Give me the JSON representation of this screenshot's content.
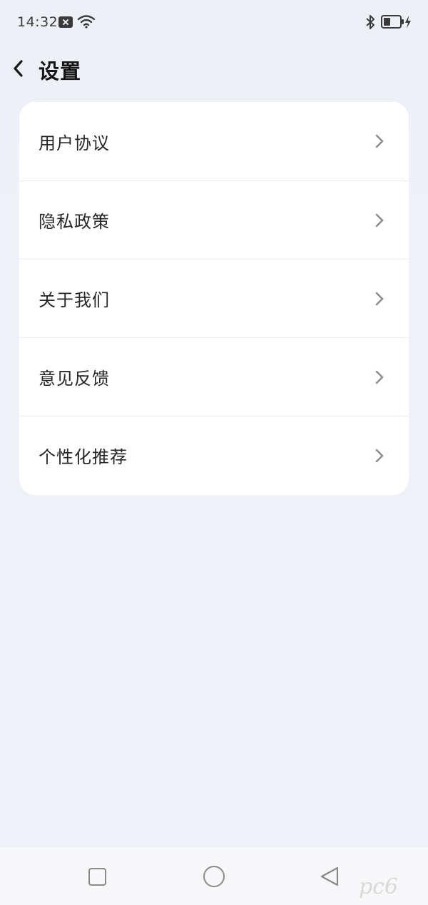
{
  "status_bar": {
    "time": "14:32",
    "icons": [
      "notification-x-icon",
      "wifi-icon",
      "bluetooth-icon",
      "battery-icon",
      "charging-icon"
    ]
  },
  "header": {
    "back_icon": "chevron-left-icon",
    "title": "设置"
  },
  "settings": {
    "items": [
      {
        "label": "用户协议",
        "icon": "chevron-right-icon"
      },
      {
        "label": "隐私政策",
        "icon": "chevron-right-icon"
      },
      {
        "label": "关于我们",
        "icon": "chevron-right-icon"
      },
      {
        "label": "意见反馈",
        "icon": "chevron-right-icon"
      },
      {
        "label": "个性化推荐",
        "icon": "chevron-right-icon"
      }
    ]
  },
  "nav_bar": {
    "icons": [
      "recent-apps-icon",
      "home-icon",
      "back-triangle-icon"
    ]
  },
  "watermark": {
    "text": "pc6"
  },
  "colors": {
    "background": "#eef2f7",
    "card": "#ffffff",
    "divider": "#ebebeb",
    "text_primary": "#262626",
    "chevron": "#8c8c8c"
  }
}
